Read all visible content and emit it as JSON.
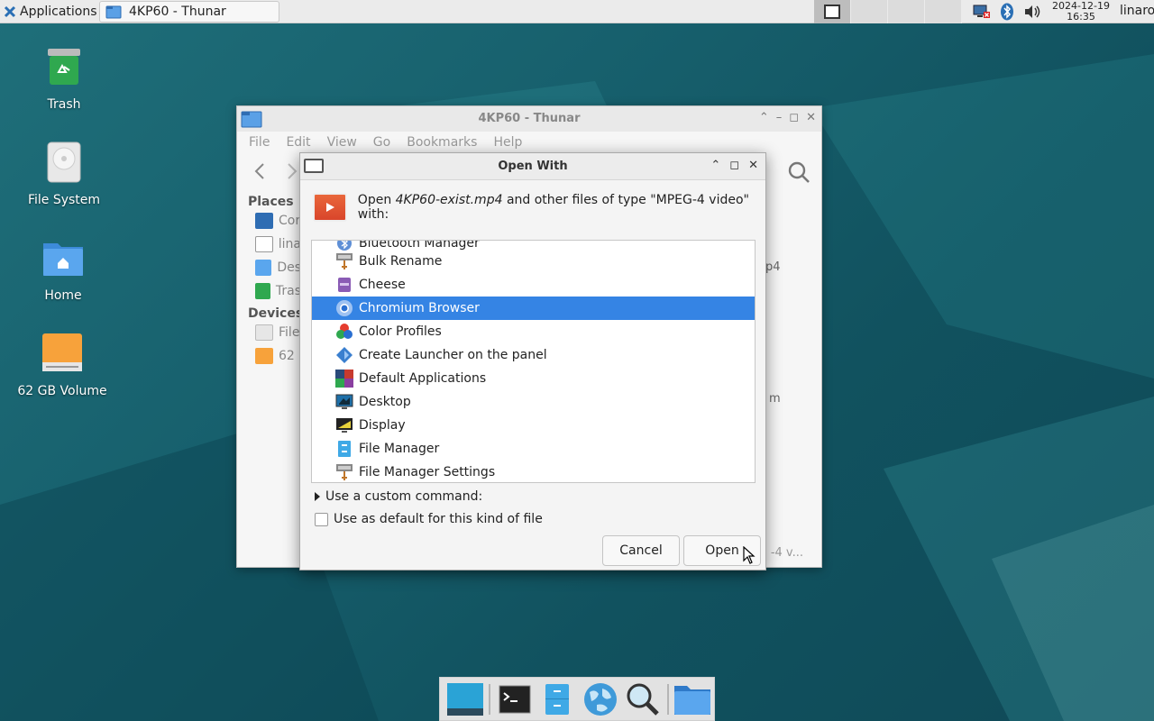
{
  "top_panel": {
    "applications_label": "Applications",
    "task_title": "4KP60 - Thunar",
    "clock_date": "2024-12-19",
    "clock_time": "16:35",
    "user": "linaro"
  },
  "desktop_icons": [
    {
      "label": "Trash",
      "icon": "trash-icon"
    },
    {
      "label": "File System",
      "icon": "drive-icon"
    },
    {
      "label": "Home",
      "icon": "home-folder-icon"
    },
    {
      "label": "62 GB Volume",
      "icon": "usb-drive-icon"
    }
  ],
  "thunar": {
    "title": "4KP60 - Thunar",
    "menu": [
      "File",
      "Edit",
      "View",
      "Go",
      "Bookmarks",
      "Help"
    ],
    "places_header": "Places",
    "places": [
      "Cor",
      "lina",
      "Des",
      "Tras"
    ],
    "devices_header": "Devices",
    "devices": [
      "File",
      "62"
    ],
    "peek_1": "p4",
    "peek_2": "m",
    "status": "-4 v..."
  },
  "dialog": {
    "title": "Open With",
    "header_prefix": "Open ",
    "header_file": "4KP60-exist.mp4",
    "header_suffix": " and other files of type \"MPEG-4 video\" with:",
    "apps": [
      {
        "label": "Bluetooth Manager",
        "icon": "bluetooth-icon",
        "selected": false
      },
      {
        "label": "Bulk Rename",
        "icon": "bulk-rename-icon",
        "selected": false
      },
      {
        "label": "Cheese",
        "icon": "cheese-icon",
        "selected": false
      },
      {
        "label": "Chromium Browser",
        "icon": "chromium-icon",
        "selected": true
      },
      {
        "label": "Color Profiles",
        "icon": "color-profiles-icon",
        "selected": false
      },
      {
        "label": "Create Launcher on the panel",
        "icon": "launcher-icon",
        "selected": false
      },
      {
        "label": "Default Applications",
        "icon": "default-apps-icon",
        "selected": false
      },
      {
        "label": "Desktop",
        "icon": "desktop-icon",
        "selected": false
      },
      {
        "label": "Display",
        "icon": "display-icon",
        "selected": false
      },
      {
        "label": "File Manager",
        "icon": "file-manager-icon",
        "selected": false
      },
      {
        "label": "File Manager Settings",
        "icon": "file-manager-settings-icon",
        "selected": false
      }
    ],
    "custom_command_label": "Use a custom command:",
    "default_label": "Use as default for this kind of file",
    "cancel_label": "Cancel",
    "open_label": "Open"
  },
  "dock": [
    "show-desktop-icon",
    "terminal-icon",
    "file-manager-icon",
    "web-browser-icon",
    "app-finder-icon",
    "home-folder-icon"
  ],
  "colors": {
    "selection": "#3584e4",
    "panel": "#ebebeb",
    "wallpaper": "#134e5e"
  }
}
